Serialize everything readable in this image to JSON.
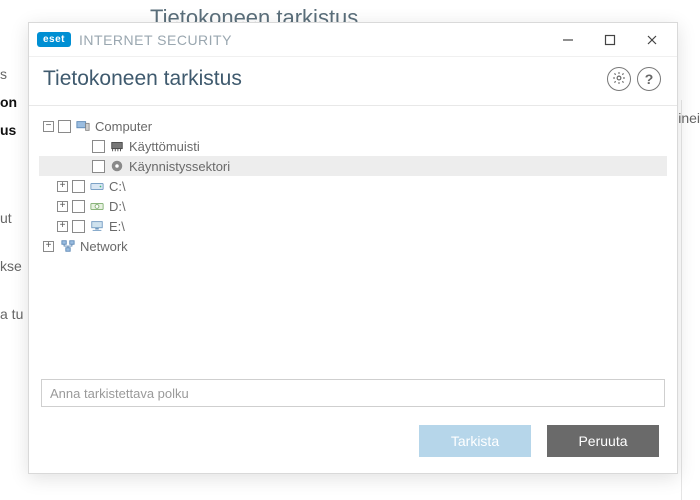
{
  "background": {
    "title": "Tietokoneen tarkistus",
    "fragments": [
      "s",
      "on",
      "us",
      "ut",
      "kse",
      "a tu",
      "inei"
    ]
  },
  "titlebar": {
    "brand_badge": "eset",
    "brand_name": "INTERNET SECURITY"
  },
  "dialog": {
    "title": "Tietokoneen tarkistus"
  },
  "tree": {
    "computer": {
      "label": "Computer",
      "children": {
        "memory": "Käyttömuisti",
        "boot": "Käynnistyssektori",
        "drive_c": "C:\\",
        "drive_d": "D:\\",
        "drive_e": "E:\\"
      }
    },
    "network": {
      "label": "Network"
    }
  },
  "path": {
    "placeholder": "Anna tarkistettava polku",
    "value": ""
  },
  "buttons": {
    "scan": "Tarkista",
    "cancel": "Peruuta"
  }
}
